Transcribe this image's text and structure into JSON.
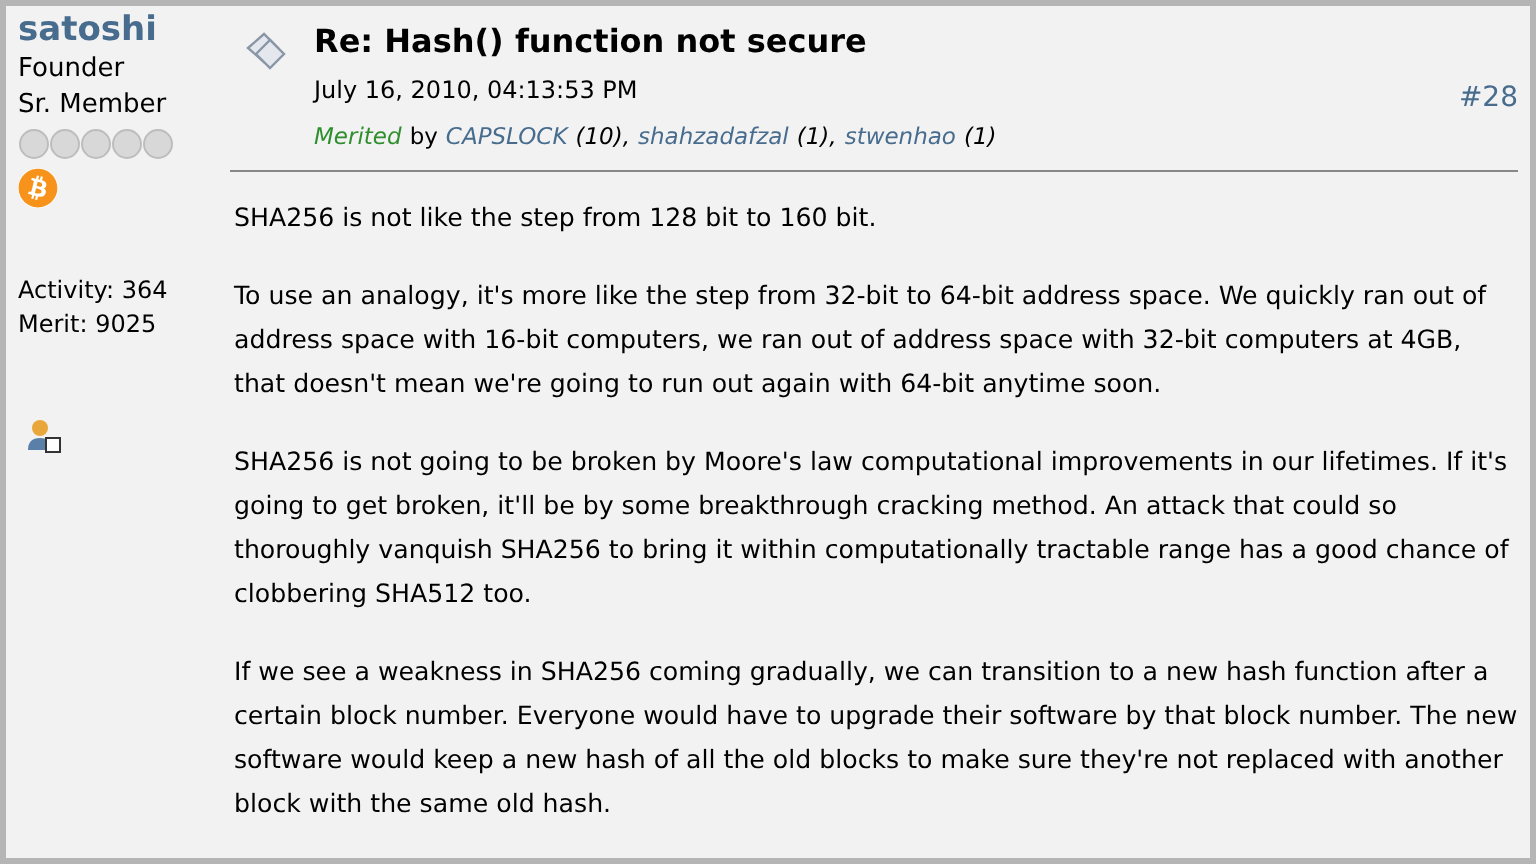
{
  "author": {
    "name": "satoshi",
    "position": "Founder",
    "rank": "Sr. Member",
    "activity": "Activity: 364",
    "merit": "Merit: 9025"
  },
  "post": {
    "title": "Re: Hash() function not secure",
    "date": "July 16, 2010, 04:13:53 PM",
    "number": "#28",
    "merited_label": "Merited",
    "merited_by": "by",
    "merits": [
      {
        "name": "CAPSLOCK",
        "count": "(10),"
      },
      {
        "name": "shahzadafzal",
        "count": "(1),"
      },
      {
        "name": "stwenhao",
        "count": "(1)"
      }
    ],
    "paragraphs": [
      "SHA256 is not like the step from 128 bit to 160 bit.",
      "To use an analogy, it's more like the step from 32-bit to 64-bit address space.  We quickly ran out of address space with 16-bit computers, we ran out of address space with 32-bit computers at 4GB, that doesn't mean we're going to run out again with 64-bit anytime soon.",
      "SHA256 is not going to be broken by Moore's law computational improvements in our lifetimes.  If it's going to get broken, it'll be by some breakthrough cracking method.  An attack that could so thoroughly vanquish SHA256 to bring it within computationally tractable range has a good chance of clobbering SHA512 too.",
      "If we see a weakness in SHA256 coming gradually, we can transition to a new hash function after a certain block number.  Everyone would have to upgrade their software by that block number.  The new software would keep a new hash of all the old blocks to make sure they're not replaced with another block with the same old hash."
    ]
  }
}
